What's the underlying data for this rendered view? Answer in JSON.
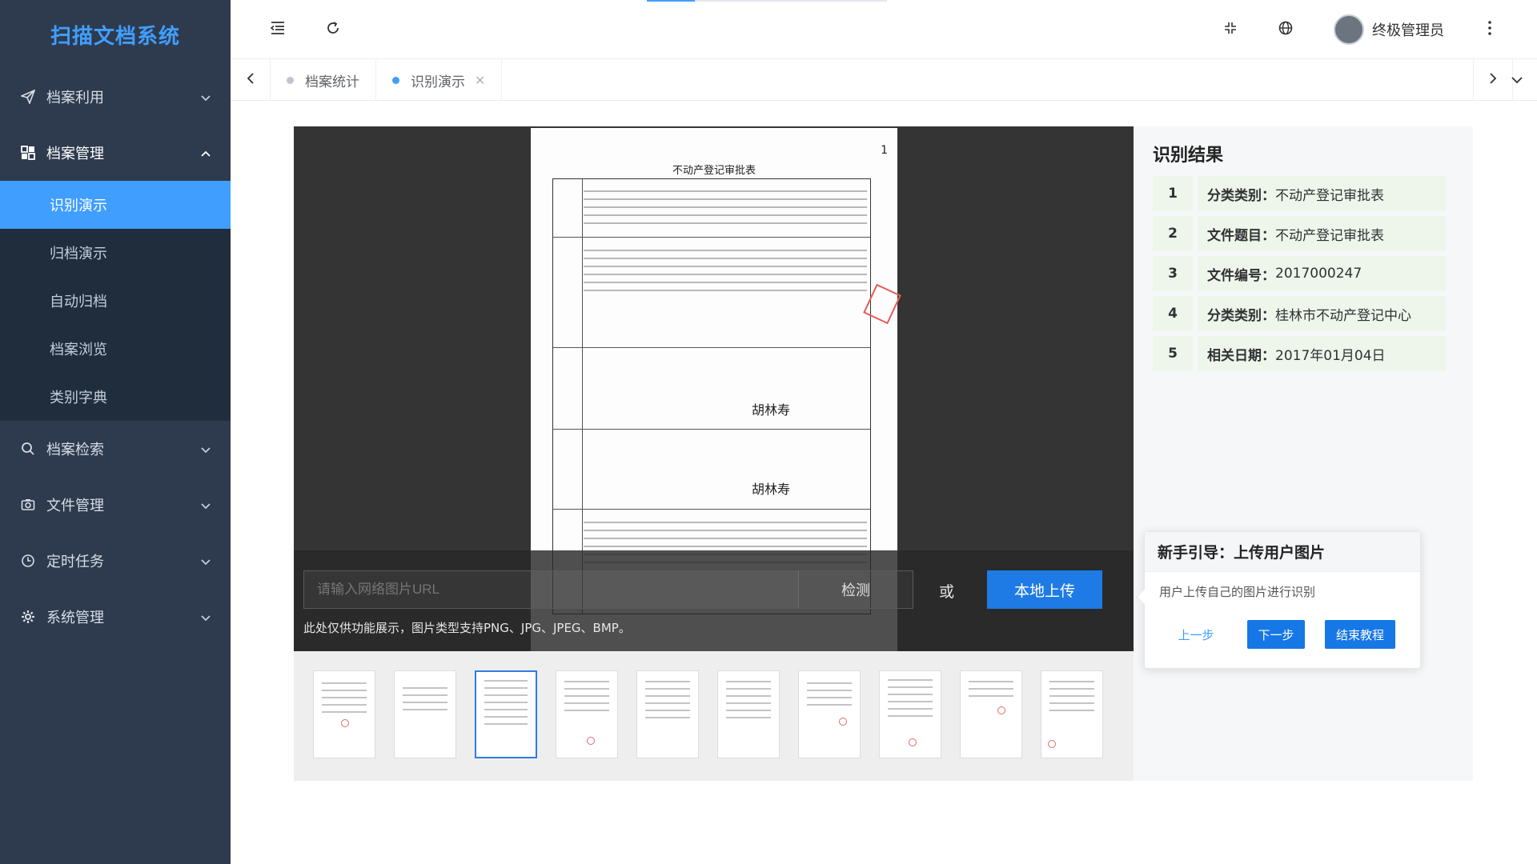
{
  "app": {
    "title": "扫描文档系统"
  },
  "sidebar": {
    "items": [
      {
        "label": "档案利用",
        "icon": "send-icon",
        "expanded": false
      },
      {
        "label": "档案管理",
        "icon": "dashboard-icon",
        "expanded": true,
        "children": [
          "识别演示",
          "归档演示",
          "自动归档",
          "档案浏览",
          "类别字典"
        ],
        "active_child": "识别演示"
      },
      {
        "label": "档案检索",
        "icon": "search-icon",
        "expanded": false
      },
      {
        "label": "文件管理",
        "icon": "camera-icon",
        "expanded": false
      },
      {
        "label": "定时任务",
        "icon": "clock-icon",
        "expanded": false
      },
      {
        "label": "系统管理",
        "icon": "gear-icon",
        "expanded": false
      }
    ]
  },
  "header": {
    "user_name": "终极管理员"
  },
  "tabs": [
    {
      "label": "档案统计",
      "active": false,
      "closable": false
    },
    {
      "label": "识别演示",
      "active": true,
      "closable": true
    }
  ],
  "document": {
    "title": "不动产登记审批表",
    "page_number": "1",
    "signatures": [
      "胡林寿",
      "胡林寿"
    ]
  },
  "upload": {
    "url_placeholder": "请输入网络图片URL",
    "detect_label": "检测",
    "or_label": "或",
    "upload_label": "本地上传",
    "hint": "此处仅供功能展示，图片类型支持PNG、JPG、JPEG、BMP。"
  },
  "thumbnails": {
    "count": 10,
    "active_index": 2
  },
  "results": {
    "title": "识别结果",
    "rows": [
      {
        "index": "1",
        "key": "分类类别：",
        "value": "不动产登记审批表"
      },
      {
        "index": "2",
        "key": "文件题目：",
        "value": "不动产登记审批表"
      },
      {
        "index": "3",
        "key": "文件编号：",
        "value": "2017000247"
      },
      {
        "index": "4",
        "key": "分类类别：",
        "value": "桂林市不动产登记中心"
      },
      {
        "index": "5",
        "key": "相关日期：",
        "value": "2017年01月04日"
      }
    ]
  },
  "guide": {
    "title": "新手引导：上传用户图片",
    "text": "用户上传自己的图片进行识别",
    "prev_label": "上一步",
    "next_label": "下一步",
    "finish_label": "结束教程"
  },
  "colors": {
    "accent": "#409eff",
    "sidebar_bg": "#2e3b4e",
    "submenu_bg": "#1f2d3d",
    "upload_btn": "#1e7be6",
    "result_bg": "#eef5ea"
  }
}
